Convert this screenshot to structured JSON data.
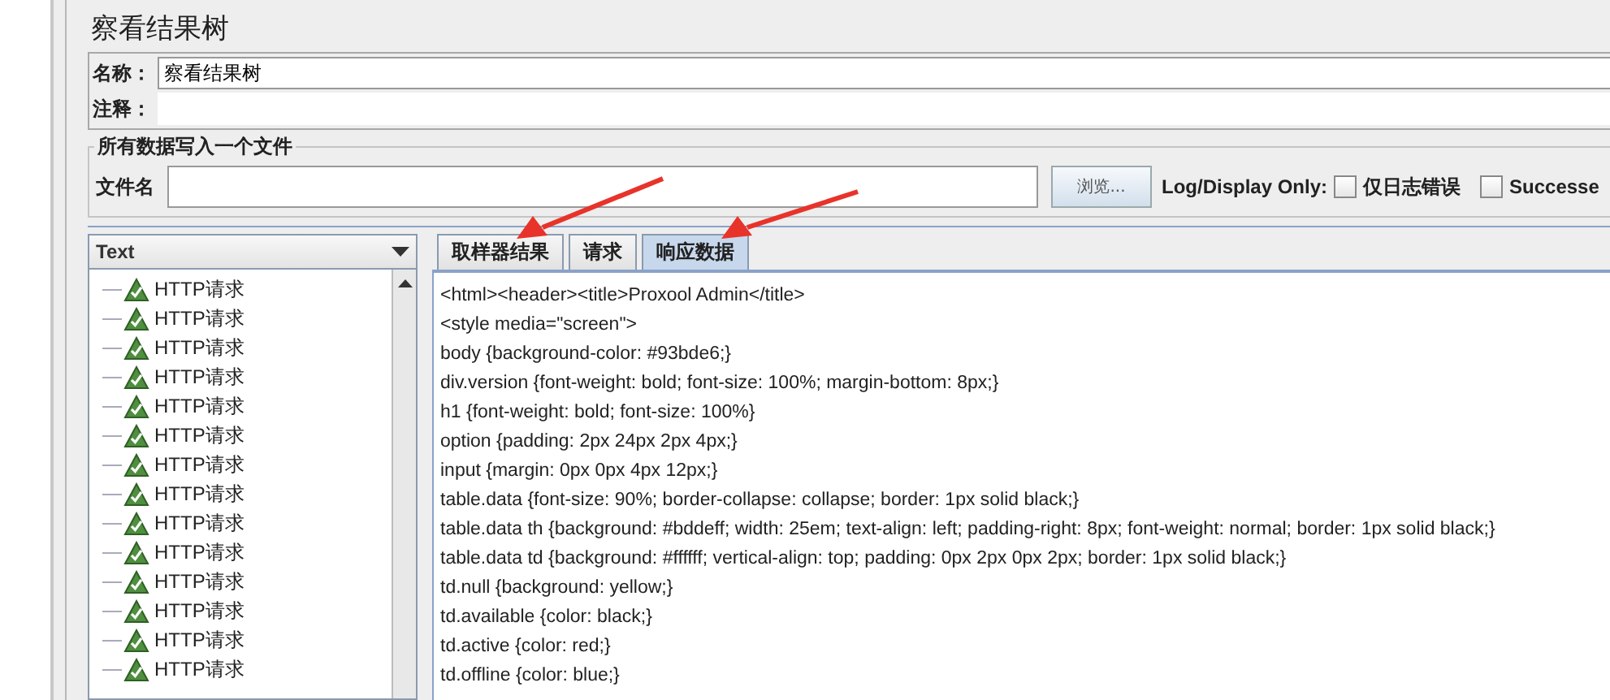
{
  "title": "察看结果树",
  "name_field": {
    "label": "名称：",
    "value": "察看结果树"
  },
  "comment_field": {
    "label": "注释："
  },
  "file_group": {
    "title": "所有数据写入一个文件",
    "label": "文件名",
    "browse_button": "浏览...",
    "log_display_label": "Log/Display Only:",
    "checkboxes": [
      {
        "label": "仅日志错误",
        "checked": false
      },
      {
        "label": "Successe",
        "checked": false
      }
    ]
  },
  "renderer": {
    "value": "Text"
  },
  "tree": {
    "items": [
      {
        "label": "HTTP请求"
      },
      {
        "label": "HTTP请求"
      },
      {
        "label": "HTTP请求"
      },
      {
        "label": "HTTP请求"
      },
      {
        "label": "HTTP请求"
      },
      {
        "label": "HTTP请求"
      },
      {
        "label": "HTTP请求"
      },
      {
        "label": "HTTP请求"
      },
      {
        "label": "HTTP请求"
      },
      {
        "label": "HTTP请求"
      },
      {
        "label": "HTTP请求"
      },
      {
        "label": "HTTP请求"
      },
      {
        "label": "HTTP请求"
      },
      {
        "label": "HTTP请求"
      }
    ]
  },
  "tabs": [
    {
      "label": "取样器结果",
      "selected": false
    },
    {
      "label": "请求",
      "selected": false
    },
    {
      "label": "响应数据",
      "selected": true
    }
  ],
  "response_lines": [
    "<html><header><title>Proxool Admin</title>",
    "<style media=\"screen\">",
    "body {background-color: #93bde6;}",
    "div.version {font-weight: bold; font-size: 100%; margin-bottom: 8px;}",
    "h1 {font-weight: bold; font-size: 100%}",
    "option {padding: 2px 24px 2px 4px;}",
    "input {margin: 0px 0px 4px 12px;}",
    "table.data {font-size: 90%; border-collapse: collapse; border: 1px solid black;}",
    "table.data th {background: #bddeff; width: 25em; text-align: left; padding-right: 8px; font-weight: normal; border: 1px solid black;}",
    "table.data td {background: #ffffff; vertical-align: top; padding: 0px 2px 0px 2px; border: 1px solid black;}",
    "td.null {background: yellow;}",
    "td.available {color: black;}",
    "td.active {color: red;}",
    "td.offline {color: blue;}"
  ]
}
